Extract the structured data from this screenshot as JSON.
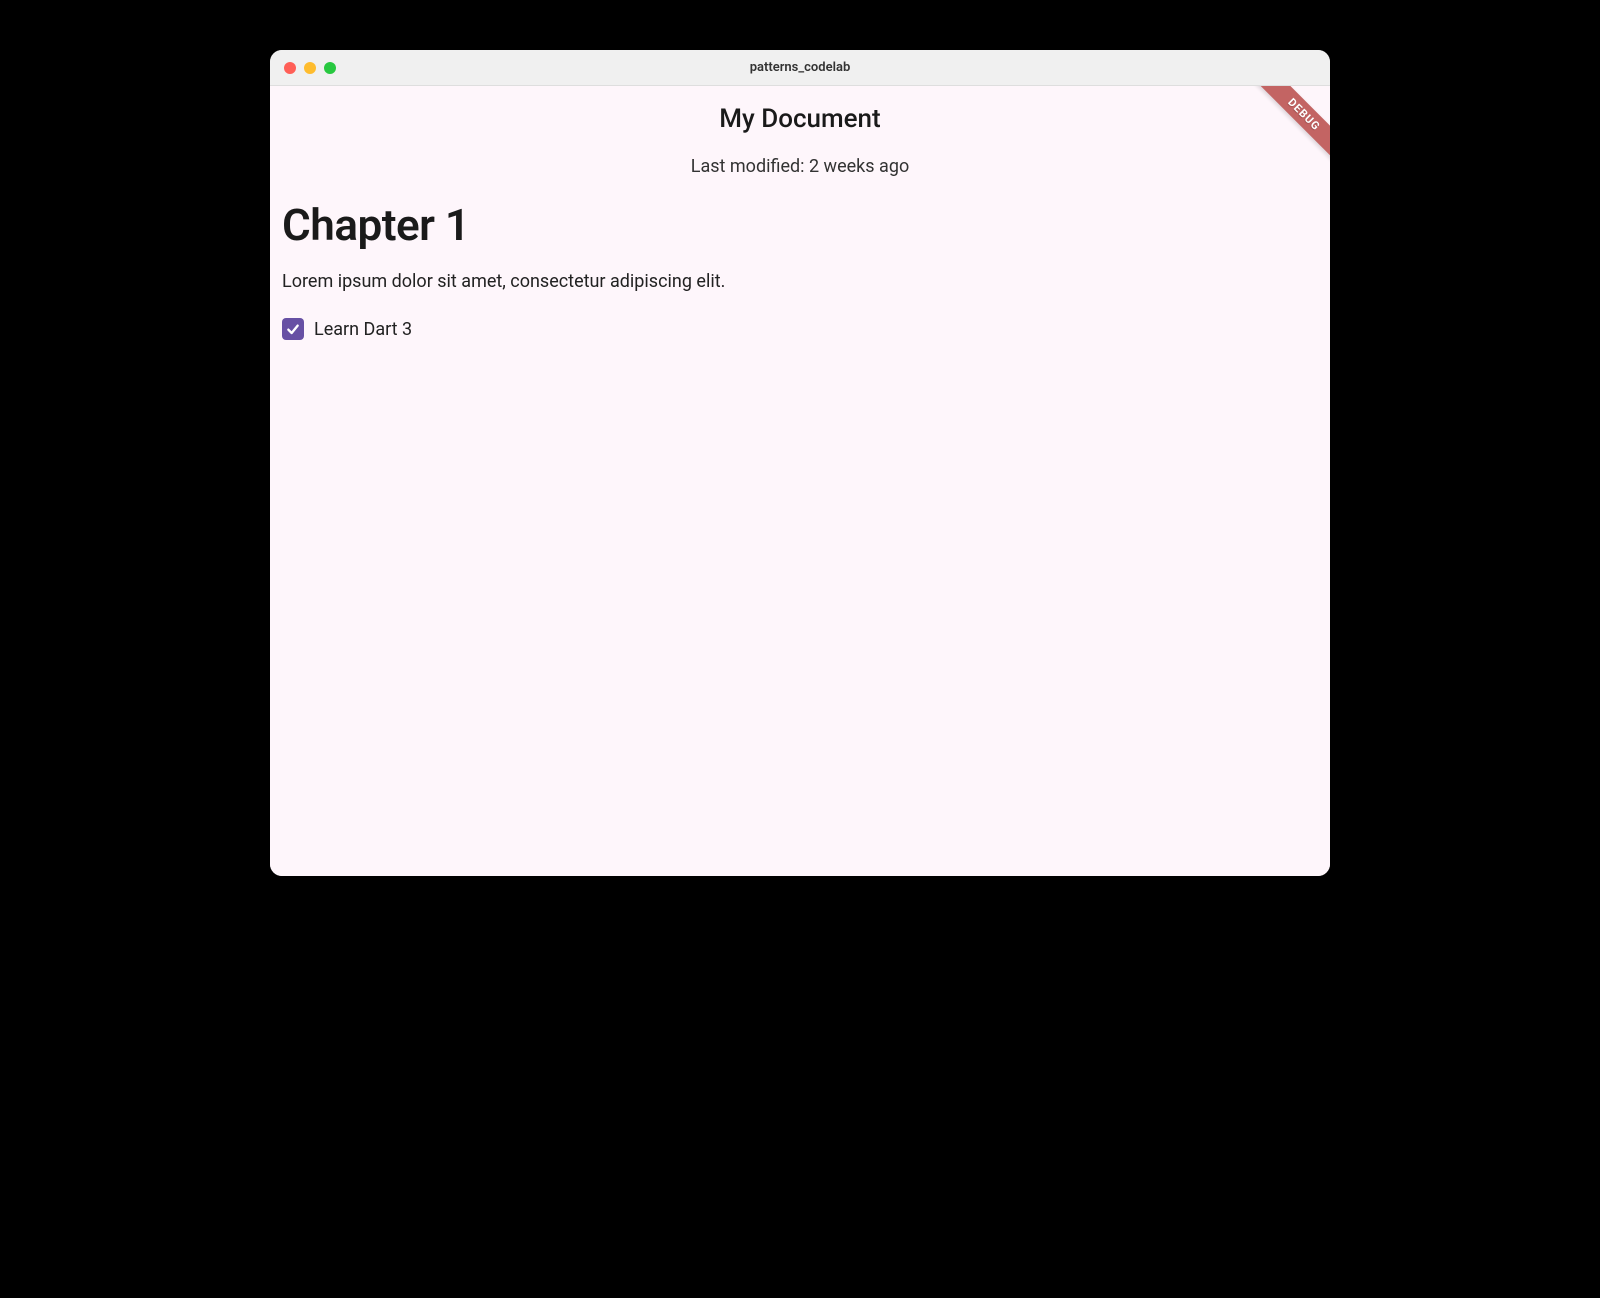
{
  "window": {
    "title": "patterns_codelab"
  },
  "debug": {
    "banner_text": "DEBUG"
  },
  "appbar": {
    "title": "My Document"
  },
  "header": {
    "last_modified": "Last modified: 2 weeks ago"
  },
  "content": {
    "heading": "Chapter 1",
    "paragraph": "Lorem ipsum dolor sit amet, consectetur adipiscing elit.",
    "checkbox": {
      "checked": true,
      "label": "Learn Dart 3"
    }
  },
  "colors": {
    "surface_tint": "#fef6fb",
    "checkbox_fill": "#6750a4",
    "debug_banner": "#c36463"
  }
}
